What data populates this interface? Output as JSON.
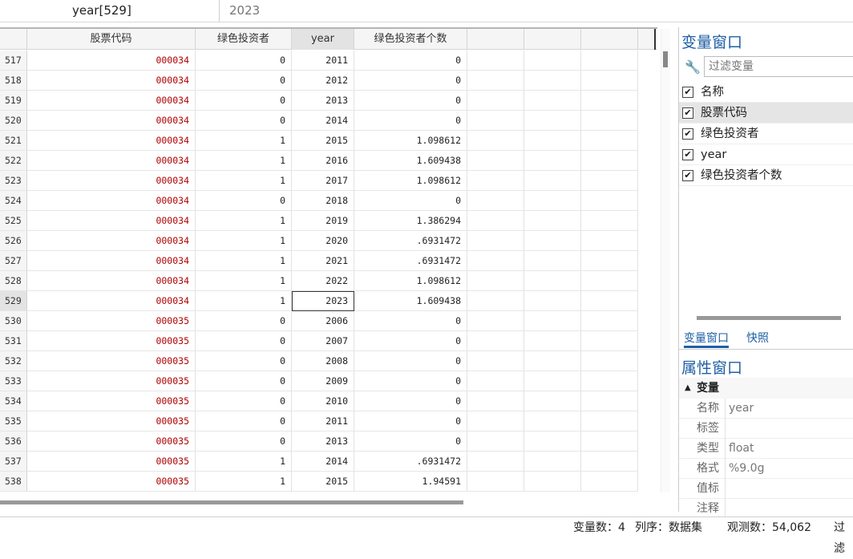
{
  "editbar": {
    "cell_ref": "year[529]",
    "cell_value": "2023"
  },
  "columns": [
    {
      "key": "code",
      "label": "股票代码"
    },
    {
      "key": "green",
      "label": "绿色投资者"
    },
    {
      "key": "year",
      "label": "year"
    },
    {
      "key": "count",
      "label": "绿色投资者个数"
    }
  ],
  "rows": [
    [
      "517",
      "000034",
      "0",
      "2011",
      "0"
    ],
    [
      "518",
      "000034",
      "0",
      "2012",
      "0"
    ],
    [
      "519",
      "000034",
      "0",
      "2013",
      "0"
    ],
    [
      "520",
      "000034",
      "0",
      "2014",
      "0"
    ],
    [
      "521",
      "000034",
      "1",
      "2015",
      "1.098612"
    ],
    [
      "522",
      "000034",
      "1",
      "2016",
      "1.609438"
    ],
    [
      "523",
      "000034",
      "1",
      "2017",
      "1.098612"
    ],
    [
      "524",
      "000034",
      "0",
      "2018",
      "0"
    ],
    [
      "525",
      "000034",
      "1",
      "2019",
      "1.386294"
    ],
    [
      "526",
      "000034",
      "1",
      "2020",
      ".6931472"
    ],
    [
      "527",
      "000034",
      "1",
      "2021",
      ".6931472"
    ],
    [
      "528",
      "000034",
      "1",
      "2022",
      "1.098612"
    ],
    [
      "529",
      "000034",
      "1",
      "2023",
      "1.609438"
    ],
    [
      "530",
      "000035",
      "0",
      "2006",
      "0"
    ],
    [
      "531",
      "000035",
      "0",
      "2007",
      "0"
    ],
    [
      "532",
      "000035",
      "0",
      "2008",
      "0"
    ],
    [
      "533",
      "000035",
      "0",
      "2009",
      "0"
    ],
    [
      "534",
      "000035",
      "0",
      "2010",
      "0"
    ],
    [
      "535",
      "000035",
      "0",
      "2011",
      "0"
    ],
    [
      "536",
      "000035",
      "0",
      "2013",
      "0"
    ],
    [
      "537",
      "000035",
      "1",
      "2014",
      ".6931472"
    ],
    [
      "538",
      "000035",
      "1",
      "2015",
      "1.94591"
    ]
  ],
  "selected_row": "529",
  "variables_panel": {
    "title": "变量窗口",
    "filter_placeholder": "过滤变量",
    "header_label": "名称",
    "items": [
      "股票代码",
      "绿色投资者",
      "year",
      "绿色投资者个数"
    ],
    "tabs": [
      "变量窗口",
      "快照"
    ]
  },
  "properties_panel": {
    "title": "属性窗口",
    "section": "变量",
    "rows": [
      {
        "key": "名称",
        "value": "year"
      },
      {
        "key": "标签",
        "value": ""
      },
      {
        "key": "类型",
        "value": "float"
      },
      {
        "key": "格式",
        "value": "%9.0g"
      },
      {
        "key": "值标",
        "value": ""
      },
      {
        "key": "注释",
        "value": ""
      }
    ]
  },
  "status": {
    "vars": "变量数：4",
    "order": "列序：数据集",
    "obs": "观测数：54,062",
    "filter": "过滤"
  },
  "colors": {
    "accent": "#1f5fa6",
    "code_text": "#b00000"
  }
}
